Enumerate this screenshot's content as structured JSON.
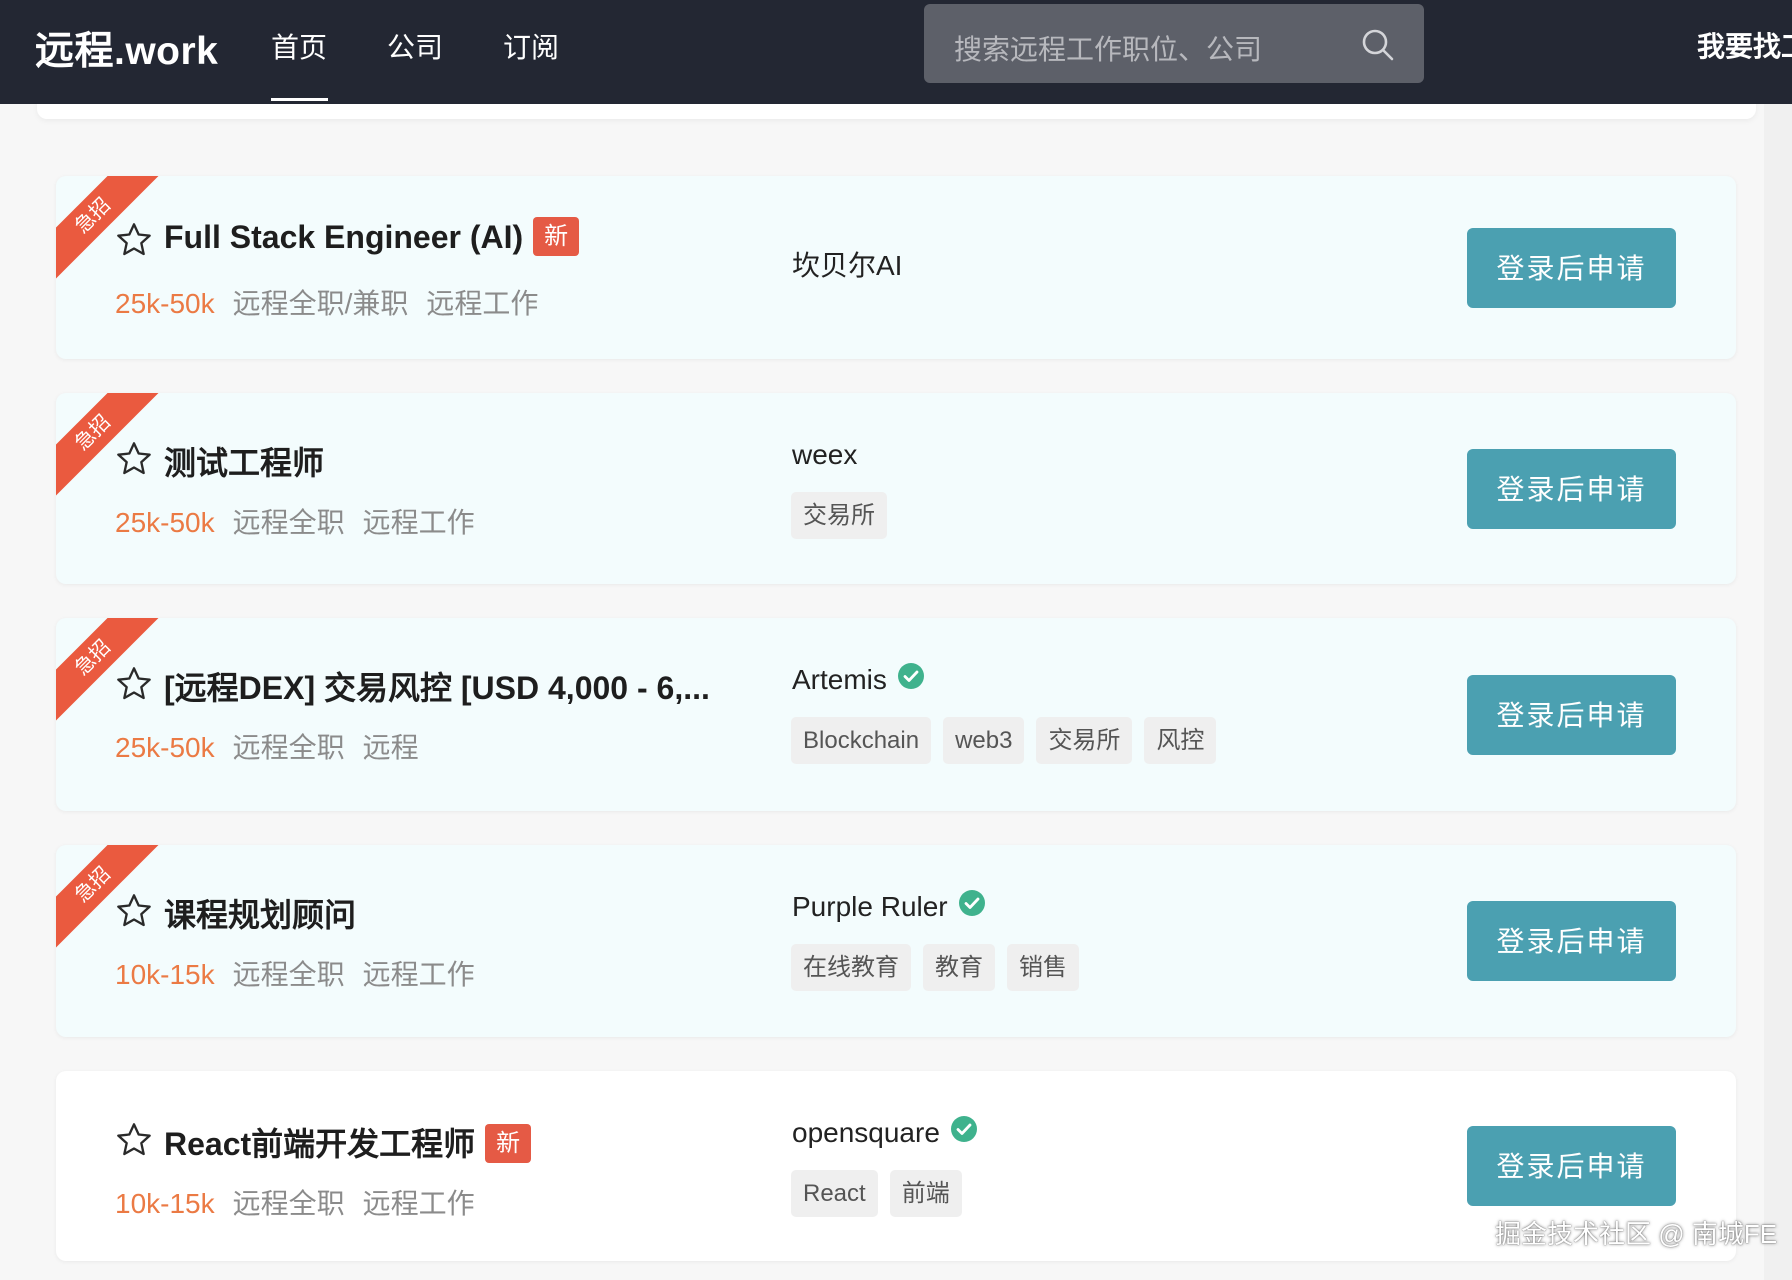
{
  "header": {
    "logo": "远程.work",
    "nav": [
      {
        "label": "首页",
        "active": true
      },
      {
        "label": "公司",
        "active": false
      },
      {
        "label": "订阅",
        "active": false
      }
    ],
    "search_placeholder": "搜索远程工作职位、公司",
    "right_link": "我要找工作"
  },
  "jobs": [
    {
      "urgent_label": "急招",
      "title": "Full Stack Engineer (AI)",
      "new_badge": "新",
      "salary": "25k-50k",
      "type": "远程全职/兼职",
      "mode": "远程工作",
      "company": "坎贝尔AI",
      "verified": false,
      "tags": [],
      "apply": "登录后申请"
    },
    {
      "urgent_label": "急招",
      "title": "测试工程师",
      "new_badge": "",
      "salary": "25k-50k",
      "type": "远程全职",
      "mode": "远程工作",
      "company": "weex",
      "verified": false,
      "tags": [
        "交易所"
      ],
      "apply": "登录后申请"
    },
    {
      "urgent_label": "急招",
      "title": "[远程DEX] 交易风控 [USD 4,000 - 6,...",
      "new_badge": "",
      "salary": "25k-50k",
      "type": "远程全职",
      "mode": "远程",
      "company": "Artemis",
      "verified": true,
      "tags": [
        "Blockchain",
        "web3",
        "交易所",
        "风控"
      ],
      "apply": "登录后申请"
    },
    {
      "urgent_label": "急招",
      "title": "课程规划顾问",
      "new_badge": "",
      "salary": "10k-15k",
      "type": "远程全职",
      "mode": "远程工作",
      "company": "Purple Ruler",
      "verified": true,
      "tags": [
        "在线教育",
        "教育",
        "销售"
      ],
      "apply": "登录后申请"
    },
    {
      "urgent_label": "",
      "title": "React前端开发工程师",
      "new_badge": "新",
      "salary": "10k-15k",
      "type": "远程全职",
      "mode": "远程工作",
      "company": "opensquare",
      "verified": true,
      "tags": [
        "React",
        "前端"
      ],
      "apply": "登录后申请"
    }
  ],
  "watermark": "掘金技术社区 @ 南城FE",
  "colors": {
    "header_bg": "#232733",
    "urgent_card_bg": "#f3fcfd",
    "ribbon": "#ea5a3f",
    "new_badge": "#e55a45",
    "salary": "#eb7a44",
    "apply_button": "#4ba0b1",
    "verified": "#3fb28d"
  }
}
